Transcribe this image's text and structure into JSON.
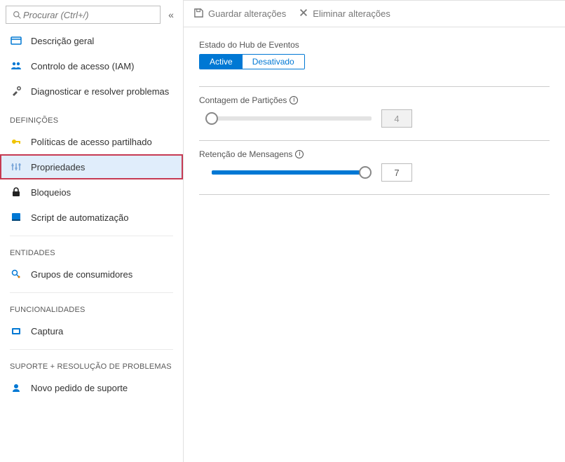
{
  "search": {
    "placeholder": "Procurar (Ctrl+/)"
  },
  "sidebar": {
    "top": [
      {
        "label": "Descrição geral",
        "icon_color": "#0078d4"
      },
      {
        "label": "Controlo de acesso (IAM)",
        "icon_color": "#0078d4"
      },
      {
        "label": "Diagnosticar e resolver problemas",
        "icon_color": "#555"
      }
    ],
    "sections": [
      {
        "title": "DEFINIÇÕES",
        "items": [
          {
            "label": "Políticas de acesso partilhado",
            "icon_color": "#f0c400"
          },
          {
            "label": "Propriedades",
            "icon_color": "#7aa6d8",
            "active": true
          },
          {
            "label": "Bloqueios",
            "icon_color": "#222"
          },
          {
            "label": "Script de automatização",
            "icon_color": "#0078d4"
          }
        ]
      },
      {
        "title": "ENTIDADES",
        "items": [
          {
            "label": "Grupos de consumidores",
            "icon_color": "#0078d4"
          }
        ]
      },
      {
        "title": "FUNCIONALIDADES",
        "items": [
          {
            "label": "Captura",
            "icon_color": "#0078d4"
          }
        ]
      },
      {
        "title": "SUPORTE + RESOLUÇÃO DE PROBLEMAS",
        "items": [
          {
            "label": "Novo pedido de suporte",
            "icon_color": "#0078d4"
          }
        ]
      }
    ]
  },
  "toolbar": {
    "save_label": "Guardar alterações",
    "discard_label": "Eliminar alterações"
  },
  "content": {
    "status_label": "Estado do Hub de Eventos",
    "status_active": "Active",
    "status_inactive": "Desativado",
    "partition_label": "Contagem de Partições",
    "partition_value": "4",
    "partition_fill_pct": 0,
    "retention_label": "Retenção de Mensagens",
    "retention_value": "7",
    "retention_fill_pct": 96
  }
}
